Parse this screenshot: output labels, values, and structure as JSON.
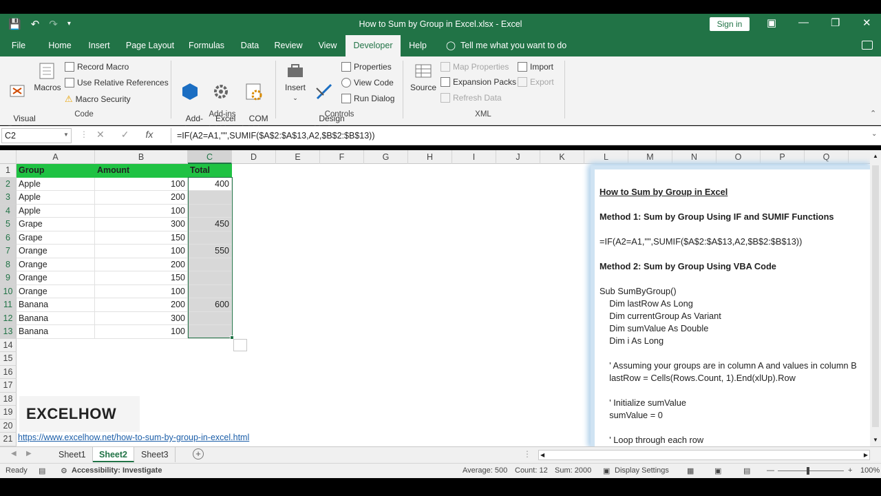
{
  "window": {
    "title": "How to Sum by Group in Excel.xlsx  -  Excel",
    "signin_label": "Sign in"
  },
  "tabs": [
    {
      "label": "File"
    },
    {
      "label": "Home"
    },
    {
      "label": "Insert"
    },
    {
      "label": "Page Layout"
    },
    {
      "label": "Formulas"
    },
    {
      "label": "Data"
    },
    {
      "label": "Review"
    },
    {
      "label": "View"
    },
    {
      "label": "Developer"
    },
    {
      "label": "Help"
    }
  ],
  "active_tab": "Developer",
  "tell_me": "Tell me what you want to do",
  "ribbon": {
    "code": {
      "visual_basic": "Visual\nBasic",
      "macros": "Macros",
      "record_macro": "Record Macro",
      "use_relative": "Use Relative References",
      "macro_security": "Macro Security",
      "group_label": "Code"
    },
    "addins": {
      "addins": "Add-\nins",
      "excel_addins": "Excel\nAdd-ins",
      "com_addins": "COM\nAdd-ins",
      "group_label": "Add-ins"
    },
    "controls": {
      "insert": "Insert",
      "design_mode": "Design\nMode",
      "properties": "Properties",
      "view_code": "View Code",
      "run_dialog": "Run Dialog",
      "group_label": "Controls"
    },
    "xml": {
      "source": "Source",
      "map_properties": "Map Properties",
      "expansion_packs": "Expansion Packs",
      "refresh_data": "Refresh Data",
      "import": "Import",
      "export": "Export",
      "group_label": "XML"
    }
  },
  "formula_bar": {
    "name_box": "C2",
    "formula": "=IF(A2=A1,\"\",SUMIF($A$2:$A$13,A2,$B$2:$B$13))"
  },
  "columns": [
    "A",
    "B",
    "C",
    "D",
    "E",
    "F",
    "G",
    "H",
    "I",
    "J",
    "K",
    "L",
    "M",
    "N",
    "O",
    "P",
    "Q"
  ],
  "rows": [
    "1",
    "2",
    "3",
    "4",
    "5",
    "6",
    "7",
    "8",
    "9",
    "10",
    "11",
    "12",
    "13",
    "14",
    "15",
    "16",
    "17",
    "18",
    "19",
    "20",
    "21"
  ],
  "headers": {
    "group": "Group",
    "amount": "Amount",
    "total": "Total"
  },
  "data": [
    {
      "group": "Apple",
      "amount": "100",
      "total": "400"
    },
    {
      "group": "Apple",
      "amount": "200",
      "total": ""
    },
    {
      "group": "Apple",
      "amount": "100",
      "total": ""
    },
    {
      "group": "Grape",
      "amount": "300",
      "total": "450"
    },
    {
      "group": "Grape",
      "amount": "150",
      "total": ""
    },
    {
      "group": "Orange",
      "amount": "100",
      "total": "550"
    },
    {
      "group": "Orange",
      "amount": "200",
      "total": ""
    },
    {
      "group": "Orange",
      "amount": "150",
      "total": ""
    },
    {
      "group": "Orange",
      "amount": "100",
      "total": ""
    },
    {
      "group": "Banana",
      "amount": "200",
      "total": "600"
    },
    {
      "group": "Banana",
      "amount": "300",
      "total": ""
    },
    {
      "group": "Banana",
      "amount": "100",
      "total": ""
    }
  ],
  "logo": "EXCELHOW",
  "link": "https://www.excelhow.net/how-to-sum-by-group-in-excel.html",
  "panel": {
    "title": "How to Sum by Group in Excel",
    "m1": "Method 1: Sum by Group Using IF and SUMIF Functions",
    "m1_formula": "=IF(A2=A1,\"\",SUMIF($A$2:$A$13,A2,$B$2:$B$13))",
    "m2": "Method 2: Sum by Group Using VBA Code",
    "code": [
      "Sub SumByGroup()",
      "    Dim lastRow As Long",
      "    Dim currentGroup As Variant",
      "    Dim sumValue As Double",
      "    Dim i As Long",
      "",
      "    ' Assuming your groups are in column A and values in column B",
      "    lastRow = Cells(Rows.Count, 1).End(xlUp).Row",
      "",
      "    ' Initialize sumValue",
      "    sumValue = 0",
      "",
      "    ' Loop through each row"
    ]
  },
  "sheets": [
    {
      "label": "Sheet1"
    },
    {
      "label": "Sheet2"
    },
    {
      "label": "Sheet3"
    }
  ],
  "active_sheet": "Sheet2",
  "status": {
    "ready": "Ready",
    "accessibility": "Accessibility: Investigate",
    "average": "Average: 500",
    "count": "Count: 12",
    "sum": "Sum: 2000",
    "display": "Display Settings",
    "zoom": "100%"
  },
  "colors": {
    "accent": "#217346",
    "header_fill": "#1fc243",
    "link": "#1a5da8"
  }
}
